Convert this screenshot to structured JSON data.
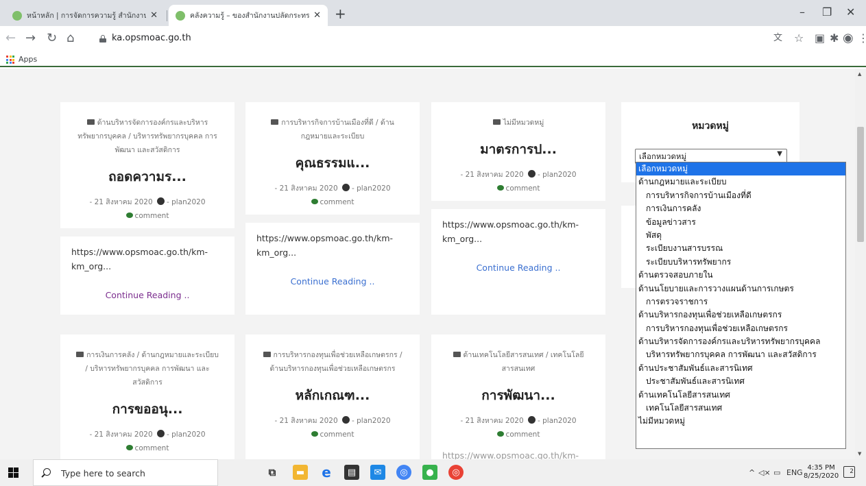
{
  "browser": {
    "tabs": [
      {
        "label": "หน้าหลัก | การจัดการความรู้ สำนักงาน",
        "active": false
      },
      {
        "label": "คลังความรู้ – ของสำนักงานปลัดกระทร",
        "active": true
      }
    ],
    "new_tab": "+",
    "window_controls": {
      "minimize": "–",
      "maximize": "❐",
      "close": "✕"
    },
    "url": "ka.opsmoac.go.th",
    "bookmarks": {
      "apps_label": "Apps"
    }
  },
  "posts": [
    {
      "category": "ด้านบริหารจัดการองค์กรและบริหารทรัพยากรบุคคล / บริหารทรัพยากรบุคคล การพัฒนา และสวัสดิการ",
      "title": "ถอดความร...",
      "date": "- 21 สิงหาคม 2020",
      "author": "- plan2020",
      "comment": "comment",
      "excerpt": "https://www.opsmoac.go.th/km-km_org...",
      "more": "Continue Reading ..",
      "more_color": "#7b2d8e"
    },
    {
      "category": "การบริหารกิจการบ้านเมืองที่ดี / ด้านกฎหมายและระเบียบ",
      "title": "คุณธรรมแ...",
      "date": "- 21 สิงหาคม 2020",
      "author": "- plan2020",
      "comment": "comment",
      "excerpt": "https://www.opsmoac.go.th/km-km_org...",
      "more": "Continue Reading ..",
      "more_color": "#3a6fd0"
    },
    {
      "category": "ไม่มีหมวดหมู่",
      "title": "มาตรการป...",
      "date": "- 21 สิงหาคม 2020",
      "author": "- plan2020",
      "comment": "comment",
      "excerpt": "https://www.opsmoac.go.th/km-km_org...",
      "more": "Continue Reading ..",
      "more_color": "#3a6fd0"
    },
    {
      "category": "การเงินการคลัง / ด้านกฎหมายและระเบียบ / บริหารทรัพยากรบุคคล การพัฒนา และสวัสดิการ",
      "title": "การขออนุ...",
      "date": "- 21 สิงหาคม 2020",
      "author": "- plan2020",
      "comment": "comment"
    },
    {
      "category": "การบริหารกองทุนเพื่อช่วยเหลือเกษตรกร / ด้านบริหารกองทุนเพื่อช่วยเหลือเกษตรกร",
      "title": "หลักเกณฑ...",
      "date": "- 21 สิงหาคม 2020",
      "author": "- plan2020",
      "comment": "comment"
    },
    {
      "category": "ด้านเทคโนโลยีสารสนเทศ / เทคโนโลยีสารสนเทศ",
      "title": "การพัฒนา...",
      "date": "- 21 สิงหาคม 2020",
      "author": "- plan2020",
      "comment": "comment",
      "excerpt_partial": "https://www.opsmoac.go.th/km-"
    }
  ],
  "sidebar": {
    "title": "หมวดหมู่",
    "select_value": "เลือกหมวดหมู่",
    "options": [
      {
        "label": "เลือกหมวดหมู่",
        "level": 0,
        "selected": true
      },
      {
        "label": "ด้านกฎหมายและระเบียบ",
        "level": 0
      },
      {
        "label": "การบริหารกิจการบ้านเมืองที่ดี",
        "level": 1
      },
      {
        "label": "การเงินการคลัง",
        "level": 1
      },
      {
        "label": "ข้อมูลข่าวสาร",
        "level": 1
      },
      {
        "label": "พัสดุ",
        "level": 1
      },
      {
        "label": "ระเบียบงานสารบรรณ",
        "level": 1
      },
      {
        "label": "ระเบียบบริหารทรัพยากร",
        "level": 1
      },
      {
        "label": "ด้านตรวจสอบภายใน",
        "level": 0
      },
      {
        "label": "ด้านนโยบายและการวางแผนด้านการเกษตร",
        "level": 0
      },
      {
        "label": "การตรวจราชการ",
        "level": 1
      },
      {
        "label": "ด้านบริหารกองทุนเพื่อช่วยเหลือเกษตรกร",
        "level": 0
      },
      {
        "label": "การบริหารกองทุนเพื่อช่วยเหลือเกษตรกร",
        "level": 1
      },
      {
        "label": "ด้านบริหารจัดการองค์กรและบริหารทรัพยากรบุคคล",
        "level": 0
      },
      {
        "label": "บริหารทรัพยากรบุคคล การพัฒนา และสวัสดิการ",
        "level": 1
      },
      {
        "label": "ด้านประชาสัมพันธ์และสารนิเทศ",
        "level": 0
      },
      {
        "label": "ประชาสัมพันธ์และสารนิเทศ",
        "level": 1
      },
      {
        "label": "ด้านเทคโนโลยีสารสนเทศ",
        "level": 0
      },
      {
        "label": "เทคโนโลยีสารสนเทศ",
        "level": 1
      },
      {
        "label": "ไม่มีหมวดหมู่",
        "level": 0
      }
    ]
  },
  "taskbar": {
    "search_placeholder": "Type here to search",
    "tray_lang": "ENG",
    "time": "4:35 PM",
    "date": "8/25/2020",
    "notification_count": "2"
  },
  "colors": {
    "accent_green": "#3a6b3a",
    "select_highlight": "#1e73e8",
    "link_blue": "#3a6fd0",
    "link_visited": "#7b2d8e"
  }
}
